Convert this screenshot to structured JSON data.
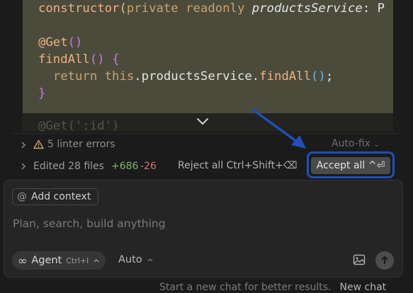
{
  "code": {
    "line1": {
      "name": "constructor",
      "open": "(",
      "kw1": "private",
      "kw2": "readonly",
      "param": "productsService",
      "rest": ": P"
    },
    "line2": {
      "decor": "@Get",
      "paren": "()"
    },
    "line3": {
      "fn": "findAll",
      "paren": "()",
      "brace": "{"
    },
    "line4": {
      "kw": "return",
      "this": "this",
      "chain": ".productsService.",
      "call": "findAll",
      "paren": "()",
      "semi": ";"
    },
    "line5": {
      "brace": "}"
    },
    "faded_line": "@Get(':id')"
  },
  "linter": {
    "text": "5 linter errors",
    "autofix": "Auto-fix"
  },
  "changes": {
    "edited": "Edited 28 files",
    "additions": "+686",
    "deletions": "-26",
    "reject_label": "Reject all Ctrl+Shift+⌫",
    "accept_label": "Accept all ^⏎"
  },
  "composer": {
    "add_context": "Add context",
    "placeholder": "Plan, search, build anything",
    "mode": "Agent",
    "mode_shortcut": "Ctrl+I",
    "model": "Auto"
  },
  "footer": {
    "text": "Start a new chat for better results.",
    "new_chat": "New chat"
  },
  "colors": {
    "accent_highlight": "#1f4fb8",
    "code_bg": "#4b4b3c",
    "additions": "#7fb36b",
    "deletions": "#d27070"
  }
}
